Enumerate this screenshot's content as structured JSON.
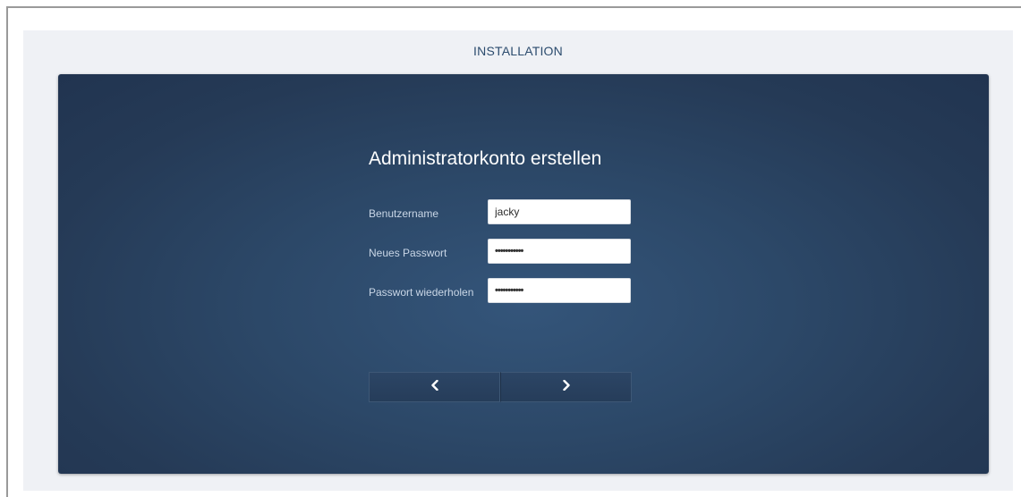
{
  "header": {
    "title": "INSTALLATION"
  },
  "form": {
    "title": "Administratorkonto erstellen",
    "fields": [
      {
        "label": "Benutzername",
        "value": "jacky",
        "type": "text"
      },
      {
        "label": "Neues Passwort",
        "value": "•••••••••••",
        "type": "password"
      },
      {
        "label": "Passwort wiederholen",
        "value": "•••••••••••",
        "type": "password"
      }
    ]
  },
  "navigation": {
    "back_icon": "chevron-left-icon",
    "next_icon": "chevron-right-icon"
  },
  "colors": {
    "header_text": "#2c4c6e",
    "card_background": "#2c4868",
    "label_text": "#c9d6e6"
  }
}
